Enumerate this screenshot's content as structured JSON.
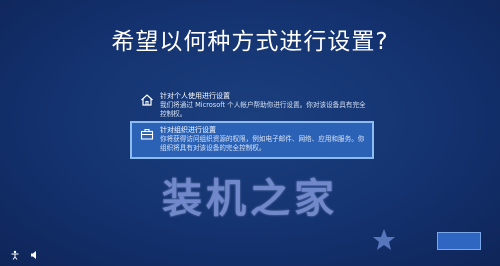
{
  "page": {
    "title": "希望以何种方式进行设置?"
  },
  "options": [
    {
      "icon": "home-icon",
      "title": "针对个人使用进行设置",
      "desc": "我们将通过 Microsoft 个人帐户帮助你进行设置。你对该设备具有完全控制权。",
      "selected": false
    },
    {
      "icon": "briefcase-icon",
      "title": "针对组织进行设置",
      "desc": "你将获得访问组织资源的权限，例如电子邮件、网络、应用和服务。你组织将具有对该设备的完全控制权。",
      "selected": true
    }
  ],
  "watermark": {
    "text": "装机之家"
  },
  "footer": {
    "next_label": ""
  },
  "colors": {
    "background": "#143270",
    "selected_fill": "#2b62b6",
    "selected_border": "#8cbcf0",
    "watermark": "#7e94d6"
  }
}
